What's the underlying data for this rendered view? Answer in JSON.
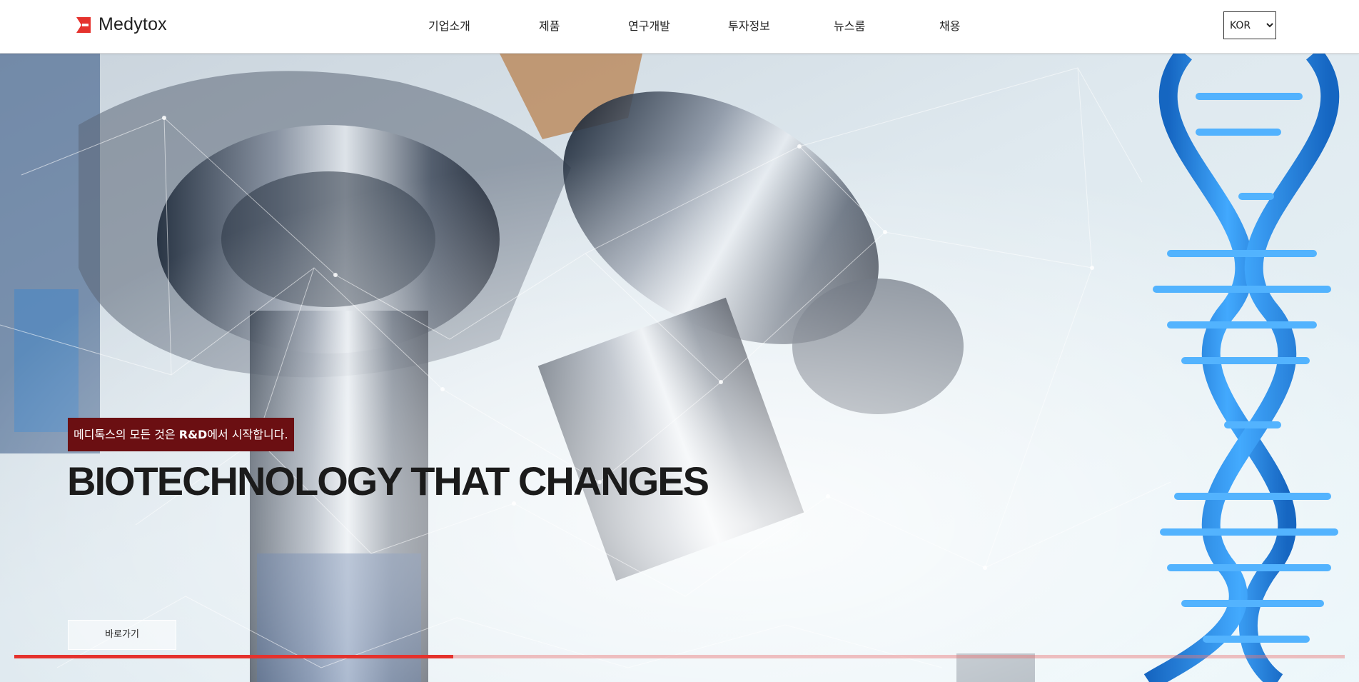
{
  "brand": {
    "name": "Medytox",
    "accent_color": "#e5322d",
    "logo_icon": "medytox-logo-icon"
  },
  "nav": {
    "items": [
      {
        "label": "기업소개"
      },
      {
        "label": "제품"
      },
      {
        "label": "연구개발"
      },
      {
        "label": "투자정보"
      },
      {
        "label": "뉴스룸"
      },
      {
        "label": "채용"
      }
    ]
  },
  "language": {
    "selected": "KOR"
  },
  "hero": {
    "tagline_prefix": "메디톡스의 모든 것은 ",
    "tagline_bold": "R&D",
    "tagline_suffix": "에서 시작합니다.",
    "tagline_bg_color": "#6b0f12",
    "headline": "BIOTECHNOLOGY THAT CHANGES",
    "cta_label": "바로가기",
    "background_image": "microscope-and-dna-helix-photo",
    "slide_progress_percent": 33
  }
}
